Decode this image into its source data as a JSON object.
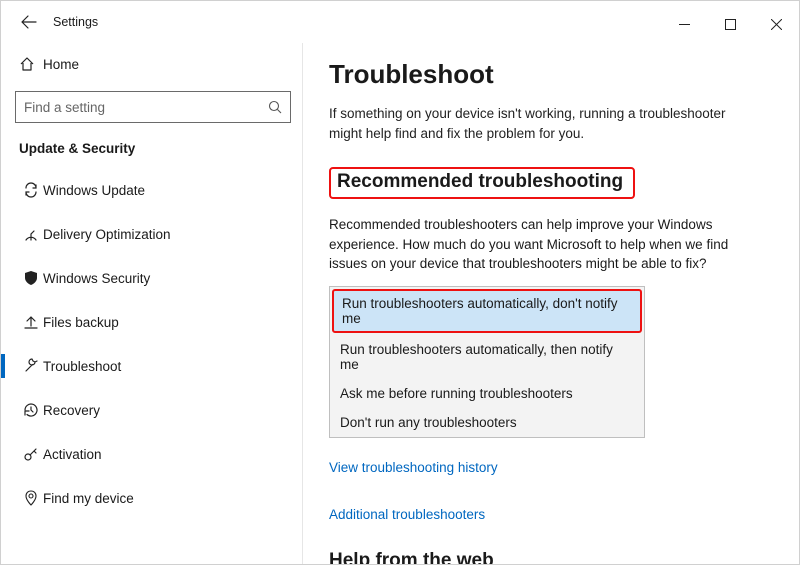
{
  "window": {
    "title": "Settings"
  },
  "sidebar": {
    "home": "Home",
    "search_placeholder": "Find a setting",
    "category": "Update & Security",
    "items": [
      {
        "label": "Windows Update"
      },
      {
        "label": "Delivery Optimization"
      },
      {
        "label": "Windows Security"
      },
      {
        "label": "Files backup"
      },
      {
        "label": "Troubleshoot"
      },
      {
        "label": "Recovery"
      },
      {
        "label": "Activation"
      },
      {
        "label": "Find my device"
      }
    ]
  },
  "main": {
    "title": "Troubleshoot",
    "description": "If something on your device isn't working, running a troubleshooter might help find and fix the problem for you.",
    "section_heading": "Recommended troubleshooting",
    "section_desc": "Recommended troubleshooters can help improve your Windows experience. How much do you want Microsoft to help when we find issues on your device that troubleshooters might be able to fix?",
    "dropdown": {
      "options": [
        "Run troubleshooters automatically, don't notify me",
        "Run troubleshooters automatically, then notify me",
        "Ask me before running troubleshooters",
        "Don't run any troubleshooters"
      ]
    },
    "link_history": "View troubleshooting history",
    "link_additional": "Additional troubleshooters",
    "help_heading": "Help from the web"
  }
}
